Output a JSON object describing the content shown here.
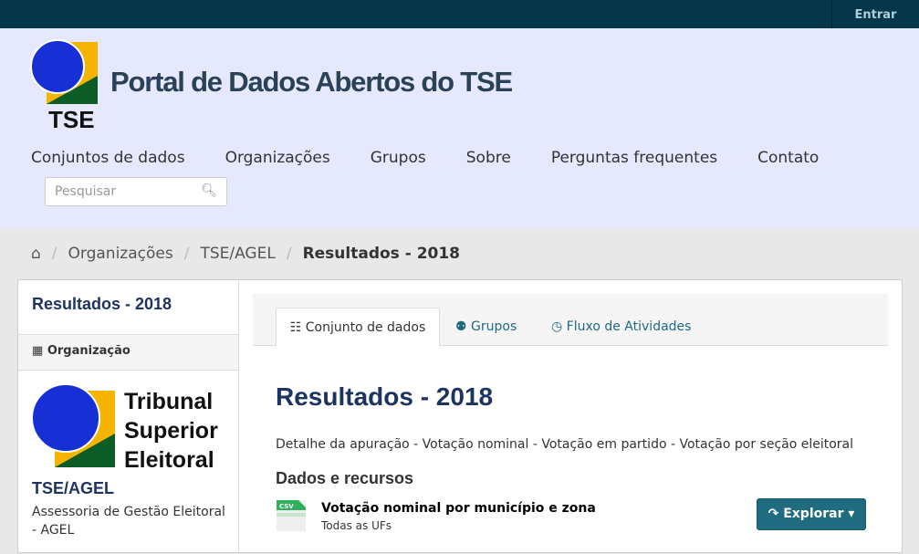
{
  "topbar": {
    "login_label": "Entrar"
  },
  "header": {
    "site_title": "Portal de Dados Abertos do TSE",
    "logo_text": "TSE"
  },
  "nav": {
    "items": [
      {
        "label": "Conjuntos de dados"
      },
      {
        "label": "Organizações"
      },
      {
        "label": "Grupos"
      },
      {
        "label": "Sobre"
      },
      {
        "label": "Perguntas frequentes"
      },
      {
        "label": "Contato"
      }
    ]
  },
  "search": {
    "placeholder": "Pesquisar"
  },
  "breadcrumb": {
    "items": [
      "Organizações",
      "TSE/AGEL"
    ],
    "current": "Resultados - 2018"
  },
  "sidebar": {
    "title": "Resultados - 2018",
    "org_heading": "Organização",
    "org_logo_text": "Tribunal Superior Eleitoral",
    "org_name": "TSE/AGEL",
    "org_desc": "Assessoria de Gestão Eleitoral - AGEL"
  },
  "tabs": [
    {
      "label": "Conjunto de dados",
      "icon": "sitemap-icon"
    },
    {
      "label": "Grupos",
      "icon": "users-icon"
    },
    {
      "label": "Fluxo de Atividades",
      "icon": "clock-icon"
    }
  ],
  "dataset": {
    "title": "Resultados - 2018",
    "notes": "Detalhe da apuração - Votação nominal - Votação em partido - Votação por seção eleitoral",
    "resources_heading": "Dados e recursos",
    "resources": [
      {
        "format": "CSV",
        "title": "Votação nominal por município e zona",
        "description": "Todas as UFs",
        "explore_label": "Explorar"
      }
    ]
  },
  "colors": {
    "topbar": "#06364a",
    "header": "#e6e8fd",
    "accent": "#1f6b80",
    "title": "#1d3461"
  }
}
